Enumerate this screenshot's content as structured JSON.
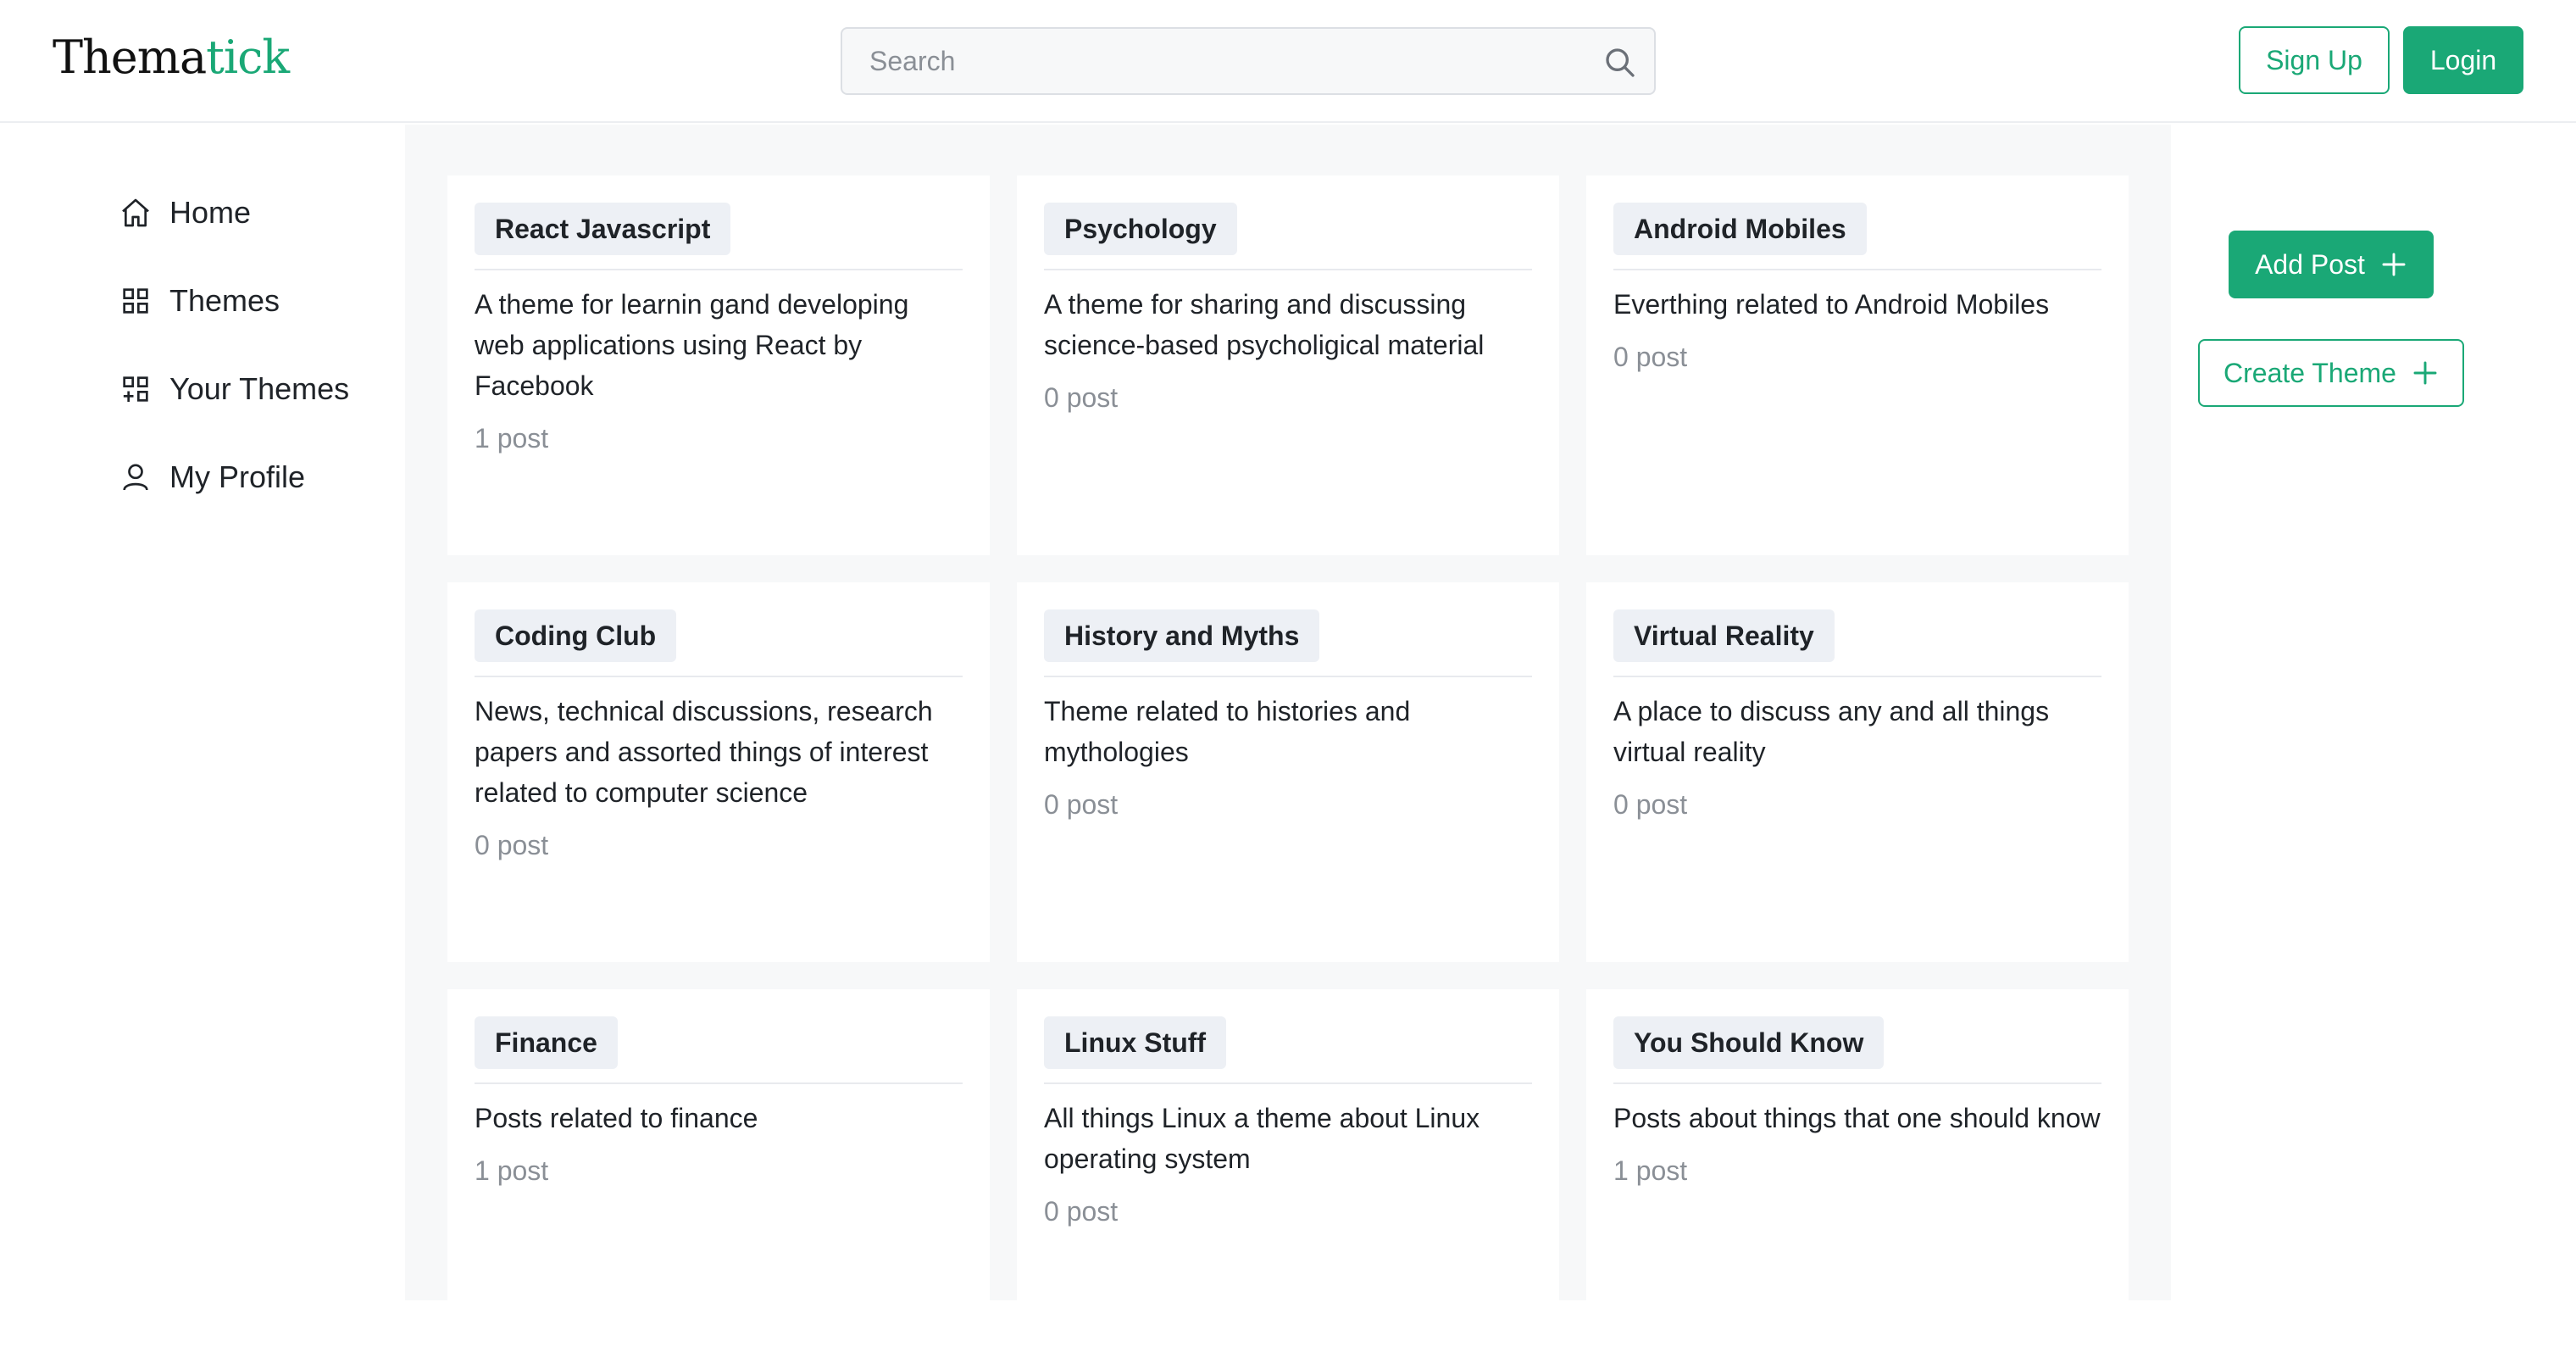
{
  "header": {
    "logo_main": "Thema",
    "logo_accent": "tick",
    "search_placeholder": "Search",
    "signup_label": "Sign Up",
    "login_label": "Login"
  },
  "sidebar": {
    "items": [
      {
        "label": "Home",
        "icon": "home-icon"
      },
      {
        "label": "Themes",
        "icon": "grid-icon"
      },
      {
        "label": "Your Themes",
        "icon": "grid-add-icon"
      },
      {
        "label": "My Profile",
        "icon": "user-icon"
      }
    ]
  },
  "actions": {
    "add_post_label": "Add Post",
    "create_theme_label": "Create Theme"
  },
  "themes": [
    {
      "name": "React Javascript",
      "description": "A theme for learnin gand developing web applications using React by Facebook",
      "posts": "1 post"
    },
    {
      "name": "Psychology",
      "description": "A theme for sharing and discussing science-based psycholigical material",
      "posts": "0 post"
    },
    {
      "name": "Android Mobiles",
      "description": "Everthing related to Android Mobiles",
      "posts": "0 post"
    },
    {
      "name": "Coding Club",
      "description": "News, technical discussions, research papers and assorted things of interest related to computer science",
      "posts": "0 post"
    },
    {
      "name": "History and Myths",
      "description": "Theme related to histories and mythologies",
      "posts": "0 post"
    },
    {
      "name": "Virtual Reality",
      "description": "A place to discuss any and all things virtual reality",
      "posts": "0 post"
    },
    {
      "name": "Finance",
      "description": "Posts related to finance",
      "posts": "1 post"
    },
    {
      "name": "Linux Stuff",
      "description": "All things Linux a theme about Linux operating system",
      "posts": "0 post"
    },
    {
      "name": "You Should Know",
      "description": "Posts about things that one should know",
      "posts": "1 post"
    }
  ],
  "colors": {
    "accent": "#1aa876",
    "tag_bg": "#edf0f5",
    "content_bg": "#f7f8f9",
    "muted_text": "#8a8f96"
  }
}
